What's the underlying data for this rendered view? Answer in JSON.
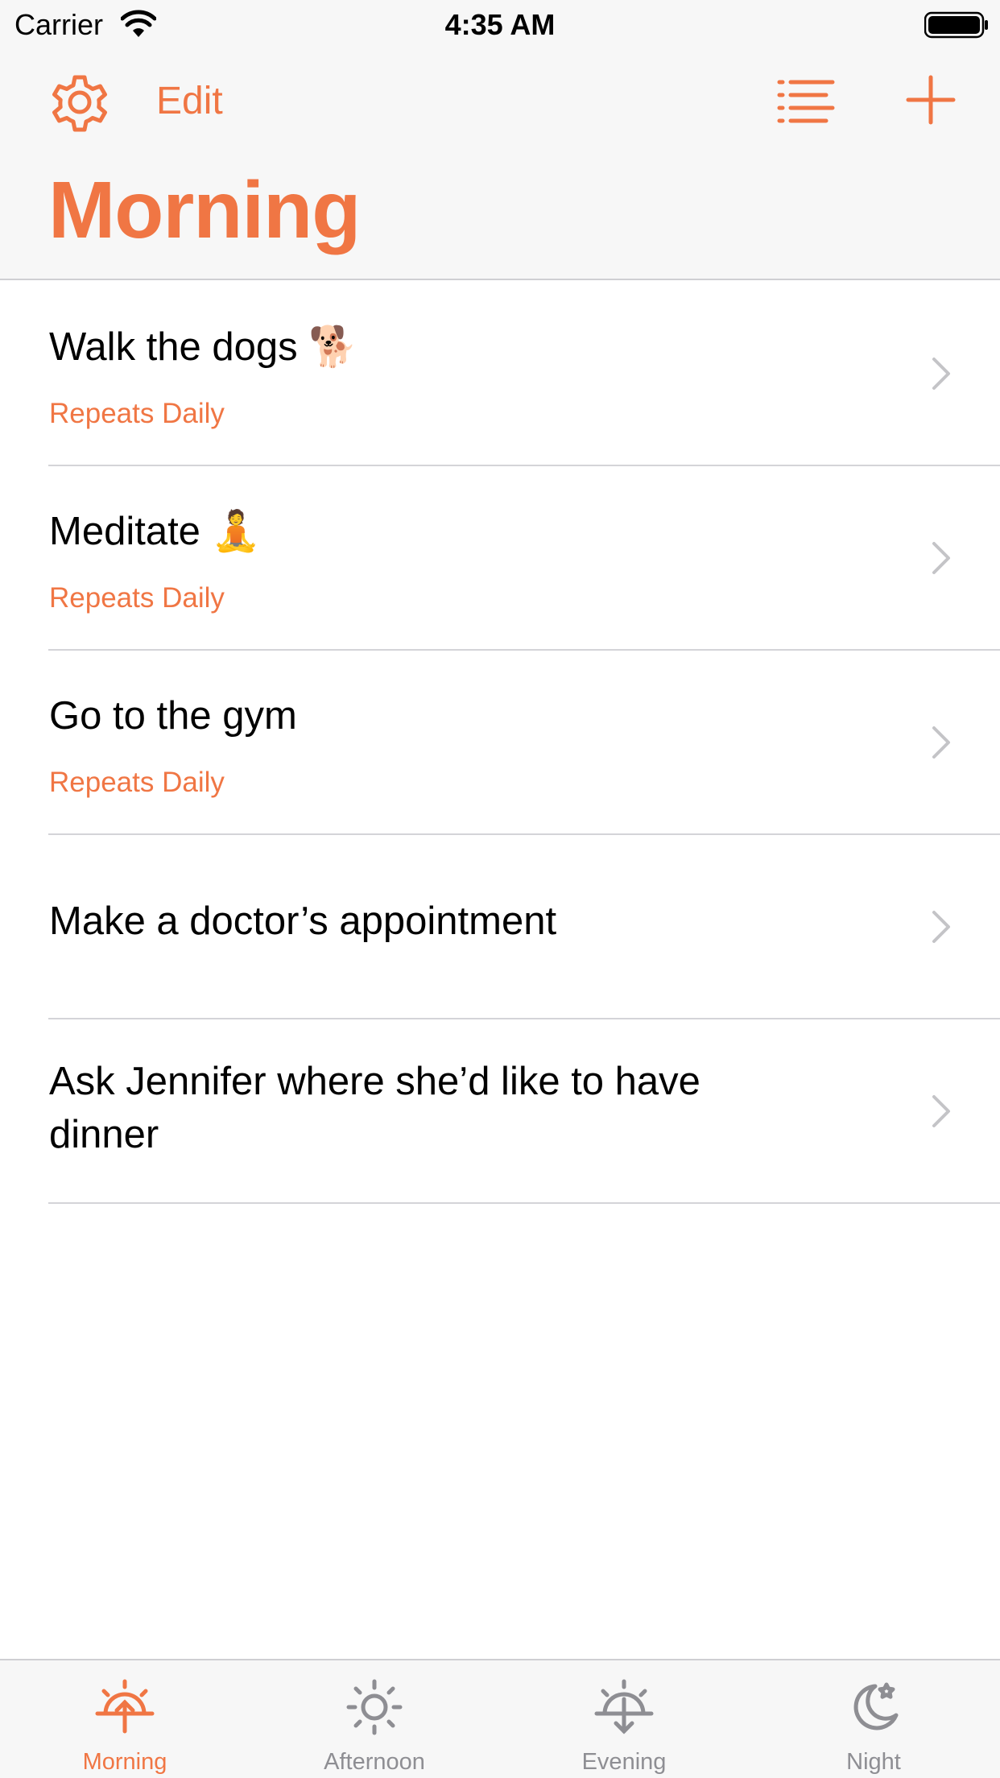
{
  "status_bar": {
    "carrier": "Carrier",
    "time": "4:35 AM"
  },
  "header": {
    "edit_label": "Edit",
    "title": "Morning"
  },
  "tasks": [
    {
      "title": "Walk the dogs 🐕",
      "subtitle": "Repeats Daily"
    },
    {
      "title": "Meditate 🧘",
      "subtitle": "Repeats Daily"
    },
    {
      "title": "Go to the gym",
      "subtitle": "Repeats Daily"
    },
    {
      "title": "Make a doctor’s appointment",
      "subtitle": ""
    },
    {
      "title": "Ask Jennifer where she’d like to have dinner",
      "subtitle": ""
    }
  ],
  "tab_bar": {
    "tabs": [
      {
        "label": "Morning",
        "icon": "sunrise-icon",
        "active": true
      },
      {
        "label": "Afternoon",
        "icon": "sun-icon",
        "active": false
      },
      {
        "label": "Evening",
        "icon": "sunset-icon",
        "active": false
      },
      {
        "label": "Night",
        "icon": "moon-star-icon",
        "active": false
      }
    ]
  },
  "colors": {
    "accent": "#f07644",
    "inactive": "#8e8e93",
    "separator": "#d4d4d8",
    "bar_background": "#f7f7f7"
  }
}
